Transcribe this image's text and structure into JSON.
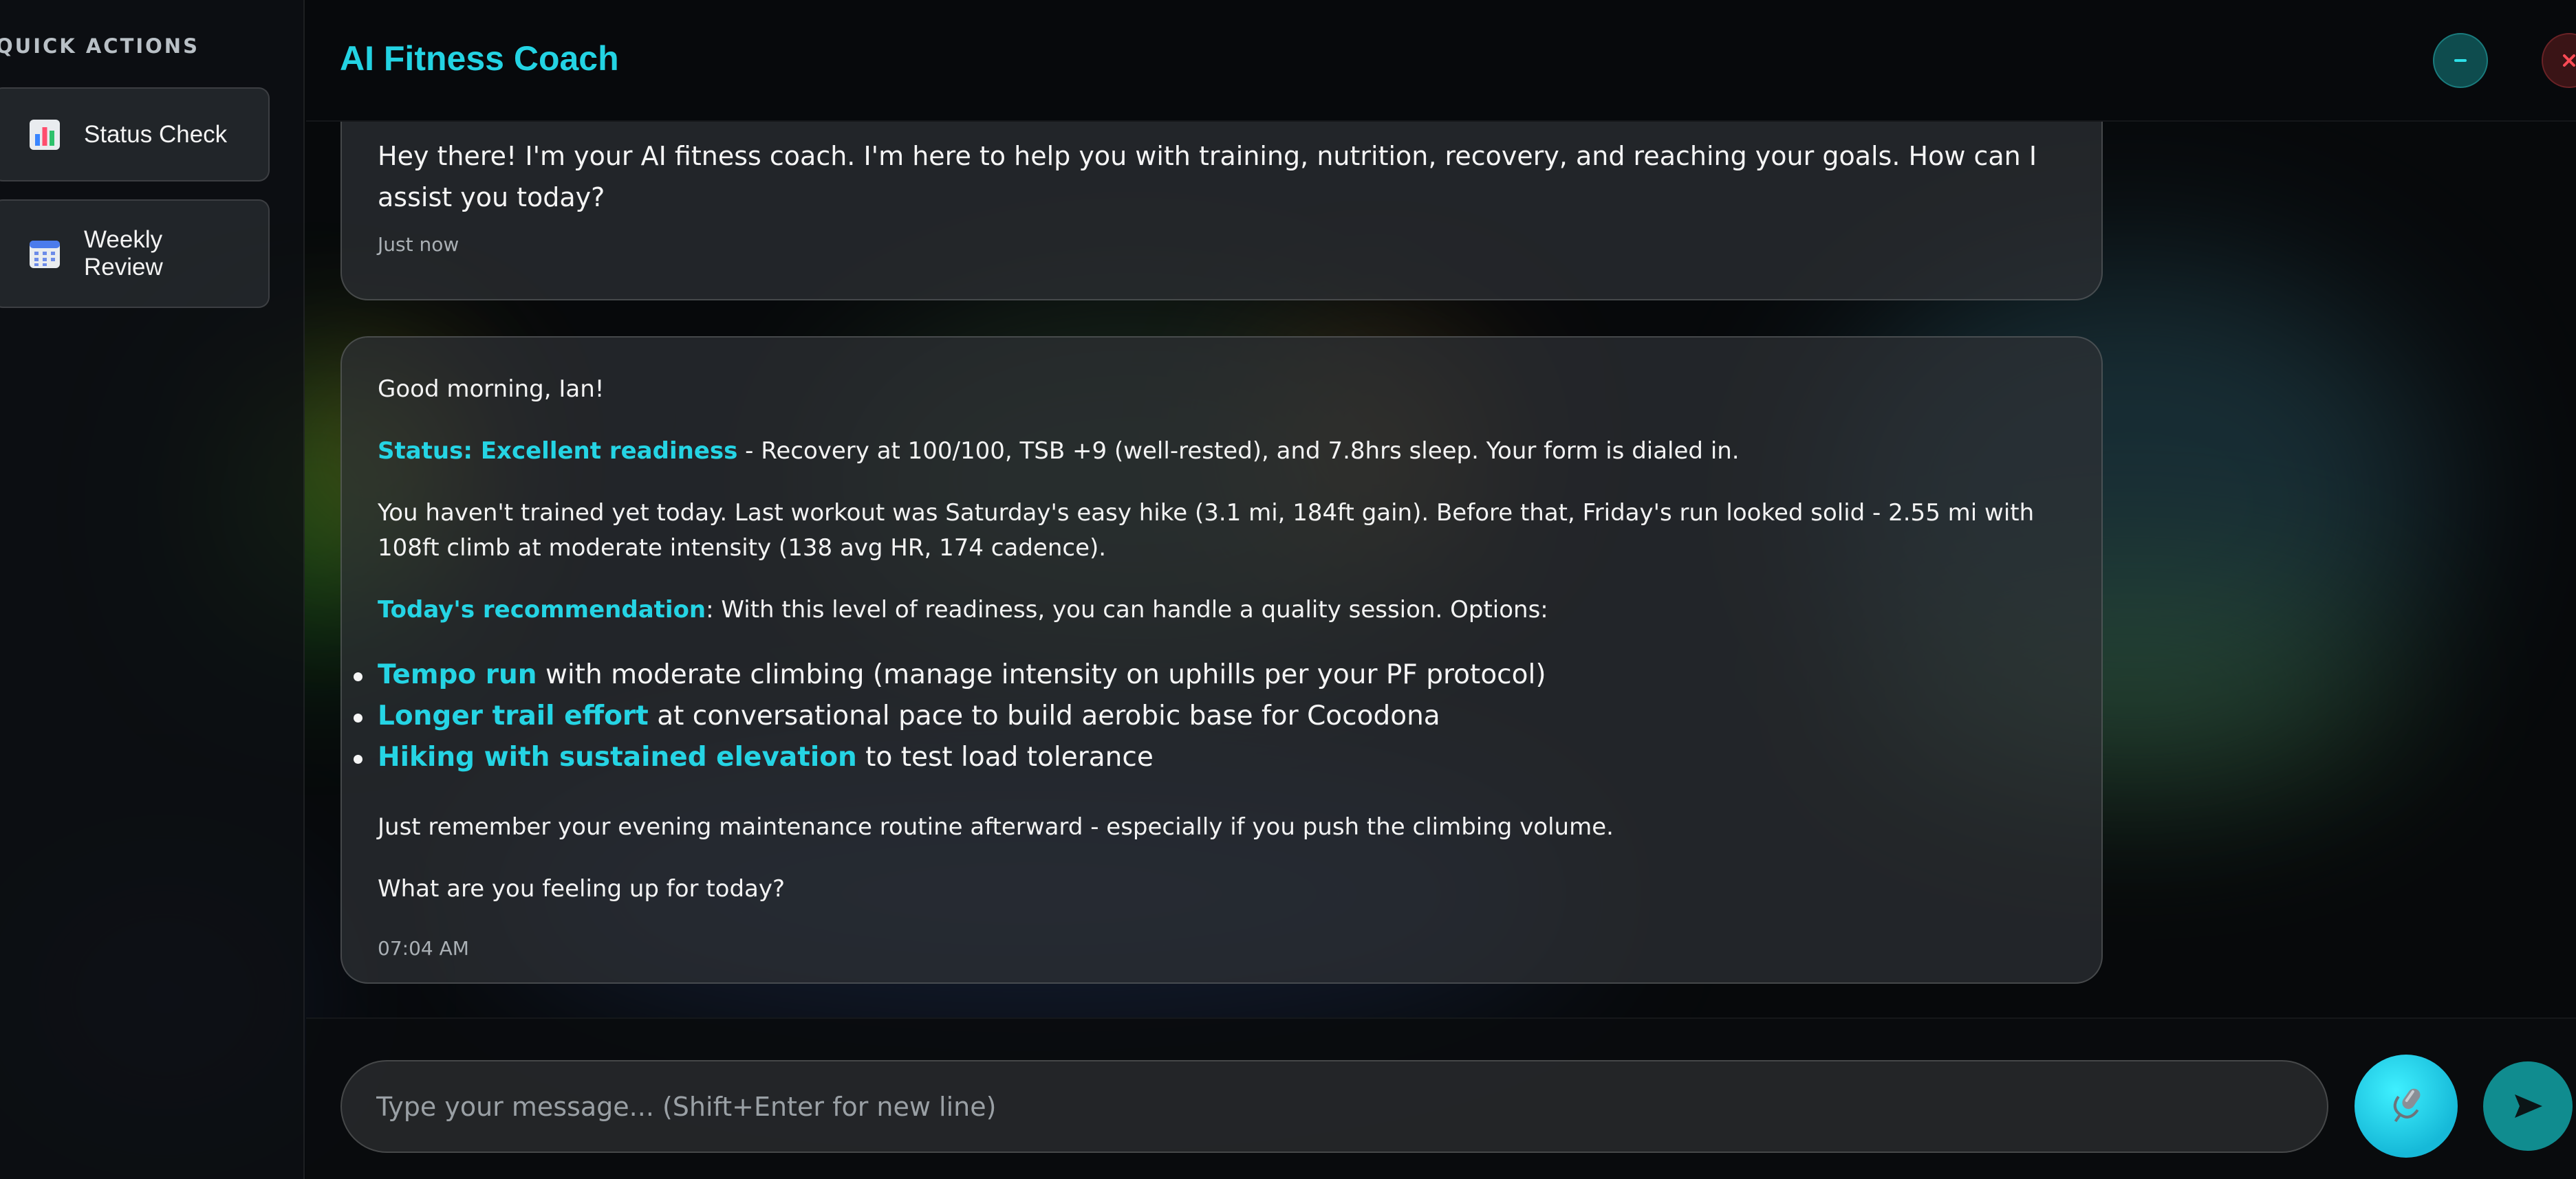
{
  "sidebar": {
    "title": "QUICK ACTIONS",
    "actions": [
      {
        "label": "Status Check",
        "icon": "bar-chart-icon"
      },
      {
        "label": "Weekly Review",
        "icon": "calendar-icon"
      }
    ]
  },
  "header": {
    "title": "AI Fitness Coach",
    "minimize_icon": "minimize-icon",
    "close_icon": "close-icon"
  },
  "messages": [
    {
      "text": "Hey there! I'm your AI fitness coach. I'm here to help you with training, nutrition, recovery, and reaching your goals. How can I assist you today?",
      "time": "Just now"
    },
    {
      "greeting": "Good morning, Ian!",
      "status_label": "Status: Excellent readiness",
      "status_text": " - Recovery at 100/100, TSB +9 (well-rested), and 7.8hrs sleep. Your form is dialed in.",
      "history": "You haven't trained yet today. Last workout was Saturday's easy hike (3.1 mi, 184ft gain). Before that, Friday's run looked solid - 2.55 mi with 108ft climb at moderate intensity (138 avg HR, 174 cadence).",
      "rec_label": "Today's recommendation",
      "rec_text": ": With this level of readiness, you can handle a quality session. Options:",
      "options": [
        {
          "label": "Tempo run",
          "text": " with moderate climbing (manage intensity on uphills per your PF protocol)"
        },
        {
          "label": "Longer trail effort",
          "text": " at conversational pace to build aerobic base for Cocodona"
        },
        {
          "label": "Hiking with sustained elevation",
          "text": " to test load tolerance"
        }
      ],
      "reminder": "Just remember your evening maintenance routine afterward - especially if you push the climbing volume.",
      "question": "What are you feeling up for today?",
      "time": "07:04 AM"
    }
  ],
  "composer": {
    "placeholder": "Type your message... (Shift+Enter for new line)",
    "mic_icon": "microphone-icon",
    "send_icon": "send-icon"
  },
  "colors": {
    "accent": "#23d3e3",
    "background": "#07090b",
    "send_button": "#108c8f",
    "close_button": "#3a1416"
  }
}
